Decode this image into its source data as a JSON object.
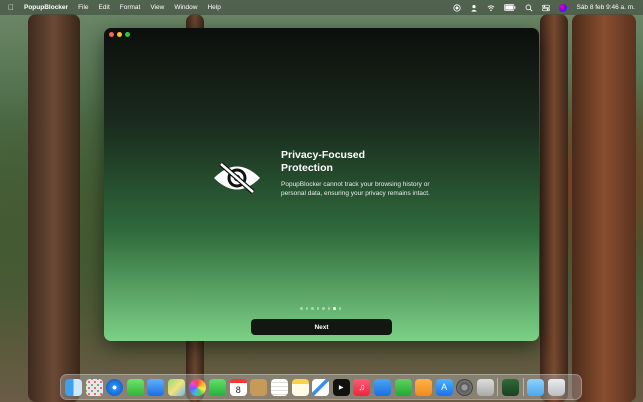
{
  "menubar": {
    "app_name": "PopupBlocker",
    "menus": [
      "File",
      "Edit",
      "Format",
      "View",
      "Window",
      "Help"
    ],
    "clock": "Sáb 8 feb  9:46 a. m."
  },
  "onboarding": {
    "title": "Privacy-Focused Protection",
    "description": "PopupBlocker cannot track your browsing history or personal data, ensuring your privacy remains intact.",
    "page_count": 8,
    "active_page": 7,
    "next_label": "Next"
  },
  "dock": {
    "calendar_day": "8",
    "apps": [
      "finder",
      "launchpad",
      "safari",
      "messages",
      "mail",
      "maps",
      "photos",
      "facetime",
      "calendar",
      "contacts",
      "reminders",
      "notes",
      "freeform",
      "tv",
      "music",
      "keynote",
      "numbers",
      "pages",
      "app-store",
      "system-settings",
      "iphone-mirroring",
      "popupblocker",
      "downloads",
      "trash"
    ]
  },
  "colors": {
    "accent_green": "#7cd186",
    "button_bg": "#121712"
  }
}
